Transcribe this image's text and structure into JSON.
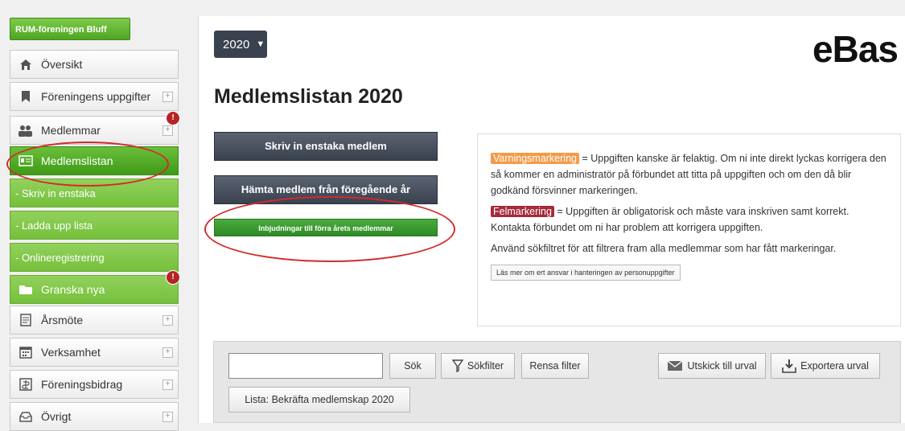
{
  "sidebar": {
    "org_name": "RUM-föreningen Bluff",
    "items": [
      {
        "label": "Översikt",
        "icon": "home-icon"
      },
      {
        "label": "Föreningens uppgifter",
        "icon": "bookmark-icon"
      },
      {
        "label": "Medlemmar",
        "icon": "users-icon",
        "badge": "!"
      },
      {
        "label": "Medlemslistan",
        "icon": "list-card-icon"
      },
      {
        "label": "- Skriv in enstaka"
      },
      {
        "label": "- Ladda upp lista"
      },
      {
        "label": "- Onlineregistrering"
      },
      {
        "label": "Granska nya",
        "icon": "folder-icon",
        "badge": "!"
      },
      {
        "label": "Årsmöte",
        "icon": "document-icon"
      },
      {
        "label": "Verksamhet",
        "icon": "calendar-icon"
      },
      {
        "label": "Föreningsbidrag",
        "icon": "money-icon"
      },
      {
        "label": "Övrigt",
        "icon": "tray-icon"
      }
    ]
  },
  "header": {
    "year": "2020",
    "brand": "eBas",
    "title": "Medlemslistan 2020"
  },
  "actions": {
    "write_single": "Skriv in enstaka medlem",
    "fetch_previous": "Hämta medlem från föregående år",
    "invitations": "Inbjudningar till förra årets medlemmar"
  },
  "info": {
    "warning_tag": "Varningsmarkering",
    "warning_text": " = Uppgiften kanske är felaktig. Om ni inte direkt lyckas korrigera den så kommer en administratör på förbundet att titta på uppgiften och om den då blir godkänd försvinner markeringen.",
    "error_tag": "Felmarkering",
    "error_text": " = Uppgiften är obligatorisk och måste vara inskriven samt korrekt. Kontakta förbundet om ni har problem att korrigera uppgiften.",
    "filter_text": "Använd sökfiltret för att filtrera fram alla medlemmar som har fått markeringar.",
    "read_more": "Läs mer om ert ansvar i hanteringen av personuppgifter"
  },
  "toolbar": {
    "search_value": "",
    "search_button": "Sök",
    "filter_button": "Sökfilter",
    "clear_button": "Rensa filter",
    "mail_button": "Utskick till urval",
    "export_button": "Exportera urval",
    "list_button": "Lista: Bekräfta medlemskap 2020"
  },
  "colors": {
    "accent_green": "#4ea523",
    "dark_button": "#3a4250",
    "warning": "#f29b4a",
    "error": "#a52a3a",
    "annotation_red": "#d32a2a"
  }
}
